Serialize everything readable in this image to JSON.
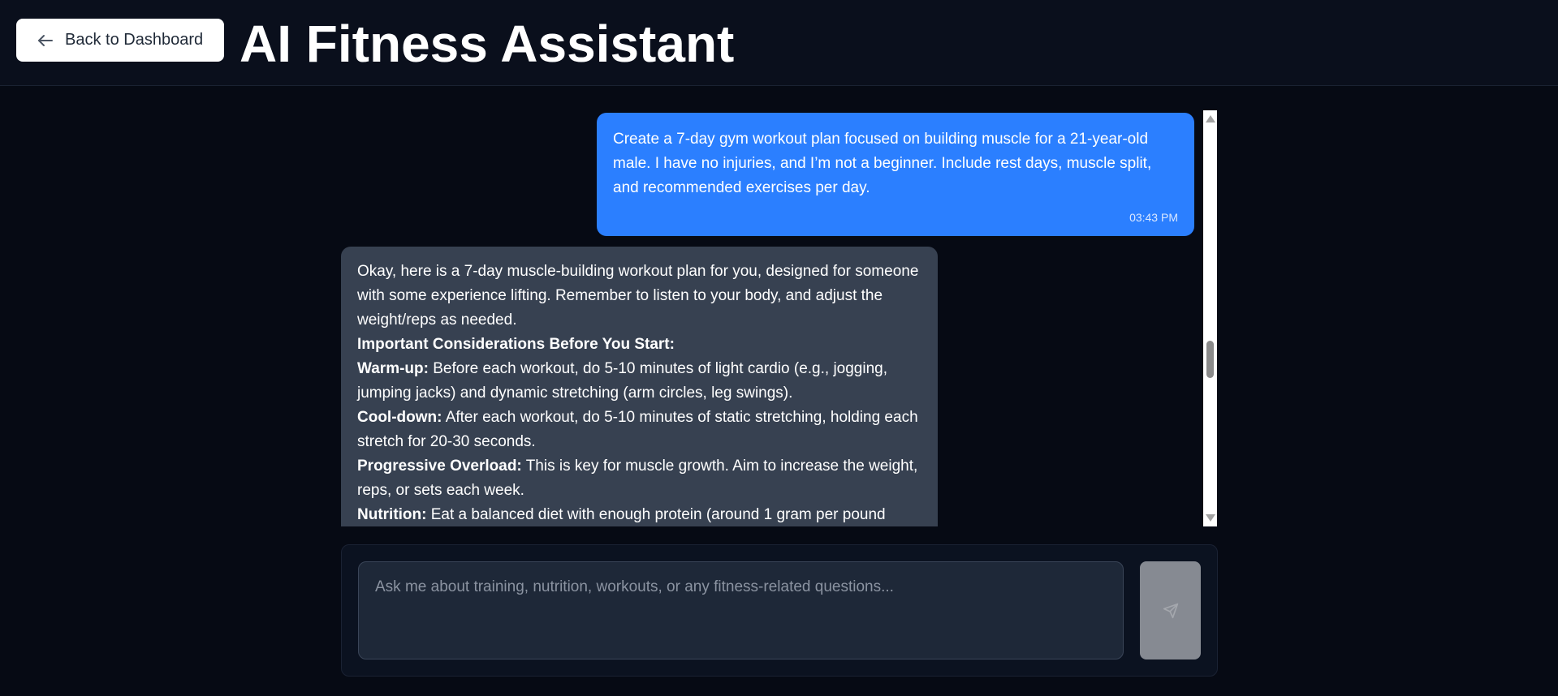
{
  "header": {
    "back_button_label": "Back to Dashboard",
    "title": "AI Fitness Assistant"
  },
  "messages": [
    {
      "role": "user",
      "text": "Create a 7-day gym workout plan focused on building muscle for a 21-year-old male. I have no injuries, and I’m not a beginner. Include rest days, muscle split, and recommended exercises per day.",
      "time": "03:43 PM"
    },
    {
      "role": "assistant",
      "intro": "Okay, here is a 7-day muscle-building workout plan for you, designed for someone with some experience lifting. Remember to listen to your body, and adjust the weight/reps as needed.",
      "section_heading": "Important Considerations Before You Start:",
      "items": [
        {
          "label": "Warm-up:",
          "text": " Before each workout, do 5-10 minutes of light cardio (e.g., jogging, jumping jacks) and dynamic stretching (arm circles, leg swings)."
        },
        {
          "label": "Cool-down:",
          "text": " After each workout, do 5-10 minutes of static stretching, holding each stretch for 20-30 seconds."
        },
        {
          "label": "Progressive Overload:",
          "text": " This is key for muscle growth. Aim to increase the weight, reps, or sets each week."
        },
        {
          "label": "Nutrition:",
          "text": " Eat a balanced diet with enough protein (around 1 gram per pound"
        }
      ]
    }
  ],
  "composer": {
    "placeholder": "Ask me about training, nutrition, workouts, or any fitness-related questions...",
    "value": "",
    "send_icon": "send-icon"
  },
  "colors": {
    "user_bubble": "#2b7fff",
    "assistant_bubble": "#374151",
    "background": "#060a14",
    "send_button_disabled": "#868a92"
  }
}
